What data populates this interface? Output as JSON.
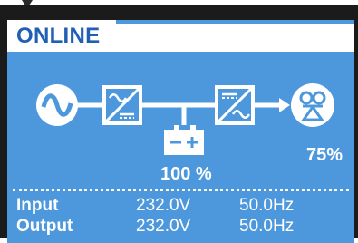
{
  "colors": {
    "lcd_background": "#4d98dc",
    "status_background": "#ffffff",
    "status_text": "#1f5fb4",
    "foreground": "#ffffff"
  },
  "status": {
    "mode": "ONLINE"
  },
  "flow_icons": {
    "input": "sine-wave-icon",
    "rectifier": "ac-dc-converter-icon",
    "battery": "battery-icon",
    "inverter": "dc-ac-inverter-icon",
    "load": "load-icon"
  },
  "battery": {
    "level": "100 %"
  },
  "load": {
    "level": "75%"
  },
  "readings": [
    {
      "label": "Input",
      "voltage": "232.0V",
      "frequency": "50.0Hz"
    },
    {
      "label": "Output",
      "voltage": "232.0V",
      "frequency": "50.0Hz"
    }
  ]
}
